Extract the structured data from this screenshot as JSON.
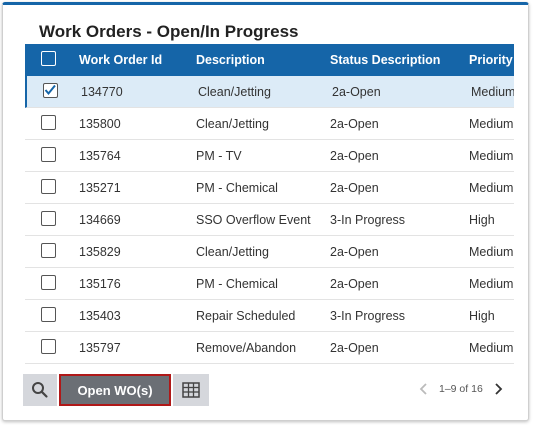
{
  "panel": {
    "title": "Work Orders - Open/In Progress"
  },
  "table": {
    "columns": [
      "Work Order Id",
      "Description",
      "Status Description",
      "Priority"
    ],
    "rows": [
      {
        "id": "134770",
        "description": "Clean/Jetting",
        "status": "2a-Open",
        "priority": "Medium",
        "checked": true
      },
      {
        "id": "135800",
        "description": "Clean/Jetting",
        "status": "2a-Open",
        "priority": "Medium",
        "checked": false
      },
      {
        "id": "135764",
        "description": "PM - TV",
        "status": "2a-Open",
        "priority": "Medium",
        "checked": false
      },
      {
        "id": "135271",
        "description": "PM - Chemical",
        "status": "2a-Open",
        "priority": "Medium",
        "checked": false
      },
      {
        "id": "134669",
        "description": "SSO Overflow Event",
        "status": "3-In Progress",
        "priority": "High",
        "checked": false
      },
      {
        "id": "135829",
        "description": "Clean/Jetting",
        "status": "2a-Open",
        "priority": "Medium",
        "checked": false
      },
      {
        "id": "135176",
        "description": "PM - Chemical",
        "status": "2a-Open",
        "priority": "Medium",
        "checked": false
      },
      {
        "id": "135403",
        "description": "Repair Scheduled",
        "status": "3-In Progress",
        "priority": "High",
        "checked": false
      },
      {
        "id": "135797",
        "description": "Remove/Abandon",
        "status": "2a-Open",
        "priority": "Medium",
        "checked": false
      }
    ]
  },
  "toolbar": {
    "search_icon": "search-icon",
    "open_label": "Open WO(s)",
    "table_icon": "table-icon"
  },
  "pager": {
    "info": "1–9 of 16"
  },
  "colors": {
    "header_bg": "#1565a8",
    "selected_row": "#dcebf7",
    "open_button": "#6b6f75",
    "focus_border": "#b01818"
  }
}
